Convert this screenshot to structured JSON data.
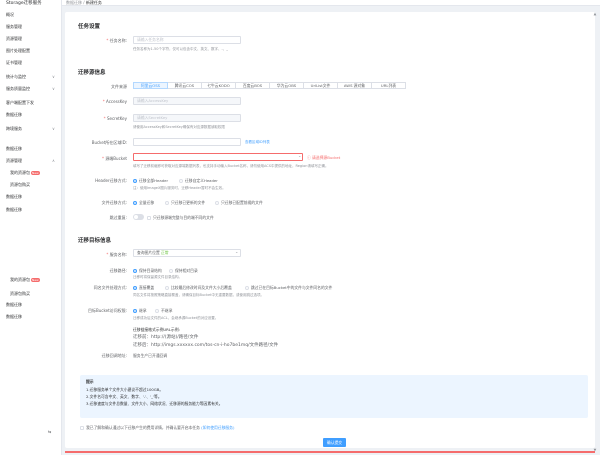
{
  "breadcrumb": {
    "parent": "数据迁移",
    "sep": "/",
    "current": "新建任务"
  },
  "sidebar": {
    "title": "Storage迁移服务",
    "items": [
      {
        "label": "概况"
      },
      {
        "label": "服务管理"
      },
      {
        "label": "资源管理"
      },
      {
        "label": "图片处理配置"
      },
      {
        "label": "证书管理"
      },
      {
        "label": "统计与监控",
        "arrow": "∨"
      },
      {
        "label": "服务质量监控",
        "arrow": "∨"
      },
      {
        "label": "客户端配置下发"
      },
      {
        "label": "数据迁移"
      },
      {
        "label": "跨境服务",
        "arrow": "∨"
      },
      {
        "label": "数据迁移"
      },
      {
        "label": "资源管理",
        "arrow": "∧"
      },
      {
        "label": "我的资源包",
        "badge": "New",
        "sub": true
      },
      {
        "label": "资源包购买",
        "sub": true
      },
      {
        "label": "数据迁移"
      },
      {
        "label": "数据迁移"
      },
      {
        "label": "我的资源包",
        "badge": "New",
        "sub": true
      },
      {
        "label": "资源包购买",
        "sub": true
      },
      {
        "label": "数据迁移"
      },
      {
        "label": "数据迁移"
      }
    ],
    "collapse": "⇆"
  },
  "task": {
    "section": "任务设置",
    "name_label": "任务名称:",
    "name_placeholder": "请输入任务名称",
    "name_hint": "任务名称为1-50个字符，仅可以包含中文、英文、数字、-、_"
  },
  "source": {
    "section": "迁移源信息",
    "vendor_label": "文件来源",
    "vendors": [
      "阿里云OSS",
      "腾讯云COS",
      "七牛云KODO",
      "百度云BOS",
      "华为云OBS",
      "UrlList文件",
      "AWS 源对象",
      "URL列表"
    ],
    "ak_label": "AccessKey",
    "ak_placeholder": "请输入AccessKey",
    "sk_label": "SecretKey",
    "sk_placeholder": "请输入SecretKey",
    "key_hint": "请使用AccessKey和SecretKey确保有对应源数据读取权限",
    "bucket_region_label": "Bucket所在区域ID:",
    "bucket_region_link": "查看区域ID列表",
    "bucket_label": "源端Bucket",
    "bucket_error": "请选择源Bucket",
    "bucket_hint": "填写了迁移前缀即可获取对应源端数据列表，也支持手动输入Bucket名称，请勿使用ACS中提供的地址，Region请填写正确。",
    "header_label": "Header迁移方式:",
    "header_opts": [
      "迁移全部Header",
      "迁移自定义Header"
    ],
    "header_hint": "注：使用ImageX图片服务时，迁移Header暂时不会生效。",
    "mode_label": "文件迁移方式:",
    "mode_opts": [
      "全量迁移",
      "只迁移已更新的文件",
      "只迁移已配置前缀的文件"
    ],
    "skip_label": "跳过重复:",
    "skip_text": "只迁移源端完整与目的端不同的文件"
  },
  "target": {
    "section": "迁移目标信息",
    "service_label": "服务名称:",
    "service_value": "查询图片位置",
    "service_tag": "正常",
    "storage_label": "迁移路径:",
    "storage_opts": [
      "保持目录结构",
      "保持相对目录"
    ],
    "storage_hint": "迁移时将保留源文件目录结构。",
    "same_label": "同名文件处理方式:",
    "same_opts": [
      "直接覆盖",
      "比较最后修改时间及文件大小后覆盖",
      "跳过已在目标Bucket中的文件与文件同名的文件"
    ],
    "same_hint": "同名文件将按照策略直接覆盖，请确保目标Bucket中无重要数据，或使用跳过选项。",
    "acl_label": "目标Bucket访问权限:",
    "acl_opts": [
      "继承",
      "不继承"
    ],
    "acl_hint": "迁移成功后文件的ACL，会继承源Bucket的对应设置。",
    "url_title": "迁移链接格式示例URL示例:",
    "url1": "迁移前：http://(源站)/路径/文件",
    "url2": "迁移后：http://imgs.xxxxxx.com/tos-cn-i-ho7be1mq/文件路径/文件",
    "callback_label": "迁移回调地址:",
    "callback_value": "服务生产已开通回调"
  },
  "tip": {
    "title": "提示",
    "line1": "1.迁移服务单个文件大小建议不超过100GB。",
    "line2": "2.文件名可含中文、英文、数字、'-'、'_'等。",
    "line3": "3.迁移速度与文件总数量、文件大小、网络状况、迁移源的服务能力等因素有关。"
  },
  "agree": {
    "text": "我已了解和确认通过以下迁移产生的费用详情，并确认要开启本任务",
    "link": "(如何使用迁移服务)"
  },
  "submit_label": "确认提交",
  "scroll": {
    "up": "▲",
    "down": "▼"
  }
}
